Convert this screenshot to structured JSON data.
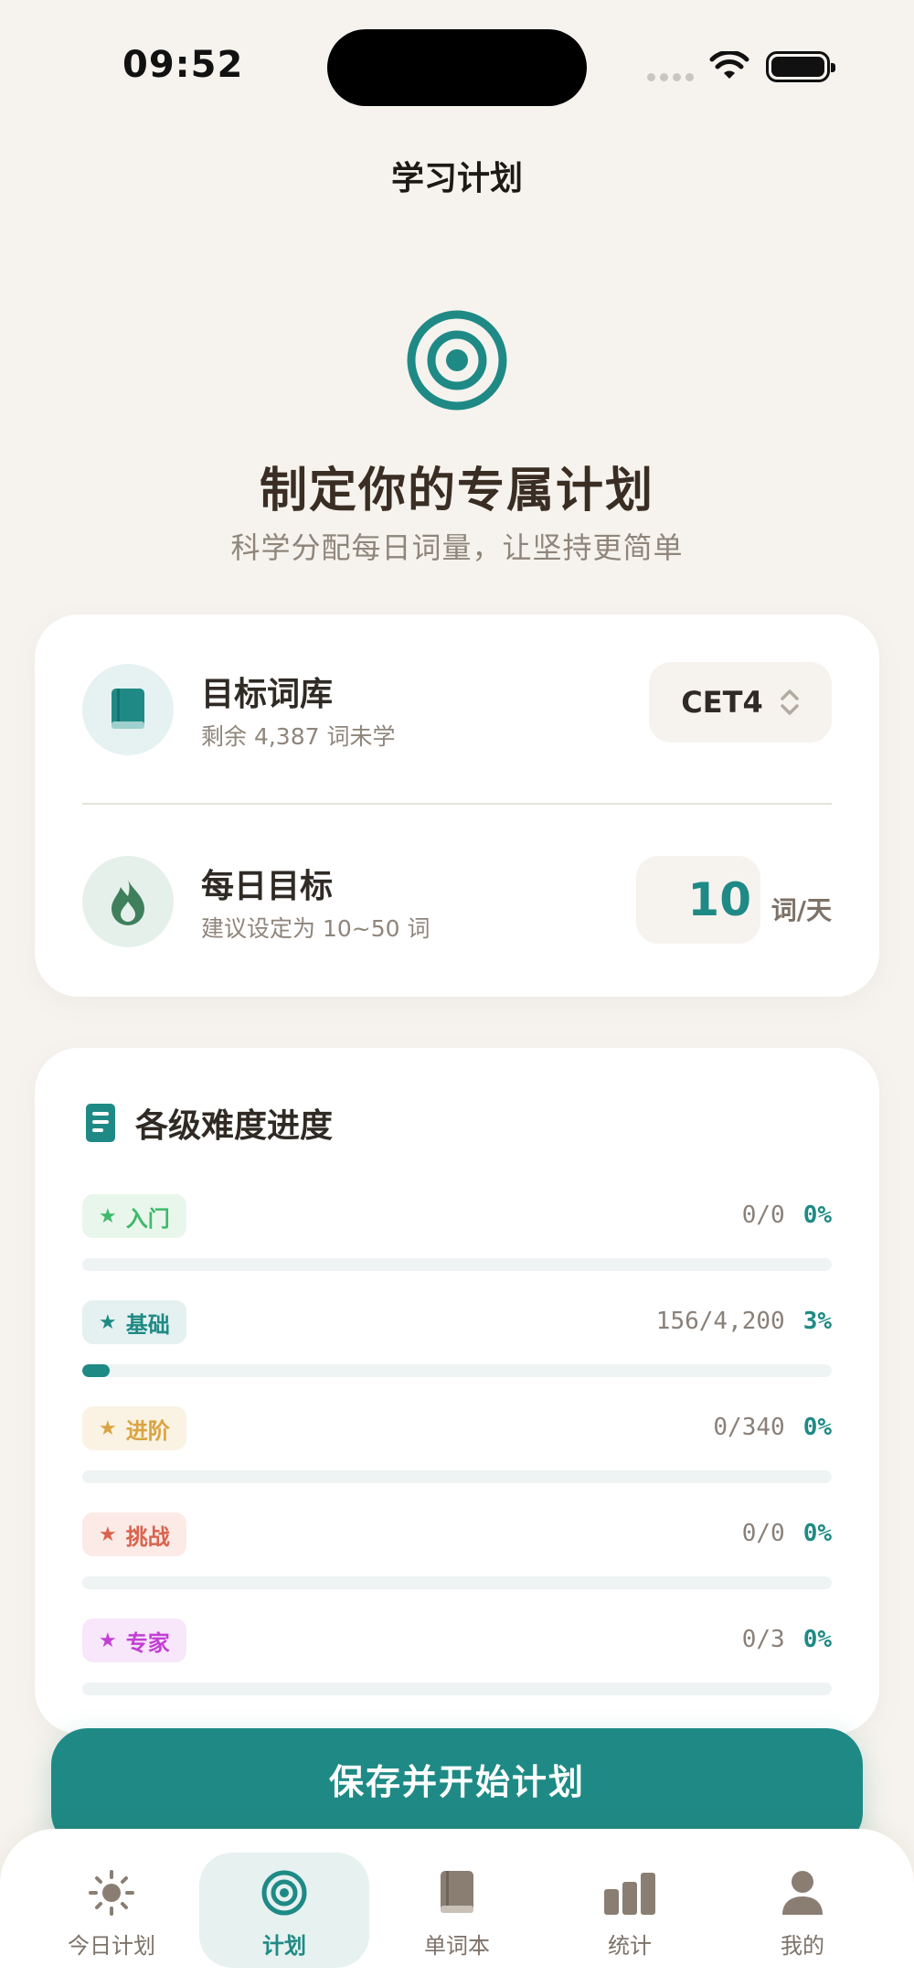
{
  "status_bar": {
    "time": "09:52"
  },
  "nav": {
    "title": "学习计划"
  },
  "hero": {
    "title": "制定你的专属计划",
    "subtitle": "科学分配每日词量，让坚持更简单"
  },
  "plan": {
    "word_bank": {
      "title": "目标词库",
      "subtitle": "剩余 4,387 词未学",
      "selected": "CET4"
    },
    "daily_goal": {
      "title": "每日目标",
      "subtitle": "建议设定为 10~50 词",
      "value": "10",
      "unit": "词/天"
    }
  },
  "progress": {
    "title": "各级难度进度",
    "levels": [
      {
        "name": "入门",
        "count": "0/0",
        "percent": "0%",
        "fraction": 0,
        "color": "#3fb96b",
        "bg": "#e9f6ec"
      },
      {
        "name": "基础",
        "count": "156/4,200",
        "percent": "3%",
        "fraction": 0.037,
        "color": "#1f8a85",
        "bg": "#e4f1f0"
      },
      {
        "name": "进阶",
        "count": "0/340",
        "percent": "0%",
        "fraction": 0,
        "color": "#d9a441",
        "bg": "#faf2e3"
      },
      {
        "name": "挑战",
        "count": "0/0",
        "percent": "0%",
        "fraction": 0,
        "color": "#d9634e",
        "bg": "#fbeae6"
      },
      {
        "name": "专家",
        "count": "0/3",
        "percent": "0%",
        "fraction": 0,
        "color": "#c23fd4",
        "bg": "#f8e6fb"
      }
    ]
  },
  "cta": {
    "label": "保存并开始计划"
  },
  "tabs": [
    {
      "label": "今日计划",
      "icon": "sun-icon",
      "active": false
    },
    {
      "label": "计划",
      "icon": "target-icon",
      "active": true
    },
    {
      "label": "单词本",
      "icon": "book-icon",
      "active": false
    },
    {
      "label": "统计",
      "icon": "bar-chart-icon",
      "active": false
    },
    {
      "label": "我的",
      "icon": "person-icon",
      "active": false
    }
  ],
  "colors": {
    "accent": "#1f8a85",
    "background": "#f6f3ee"
  }
}
